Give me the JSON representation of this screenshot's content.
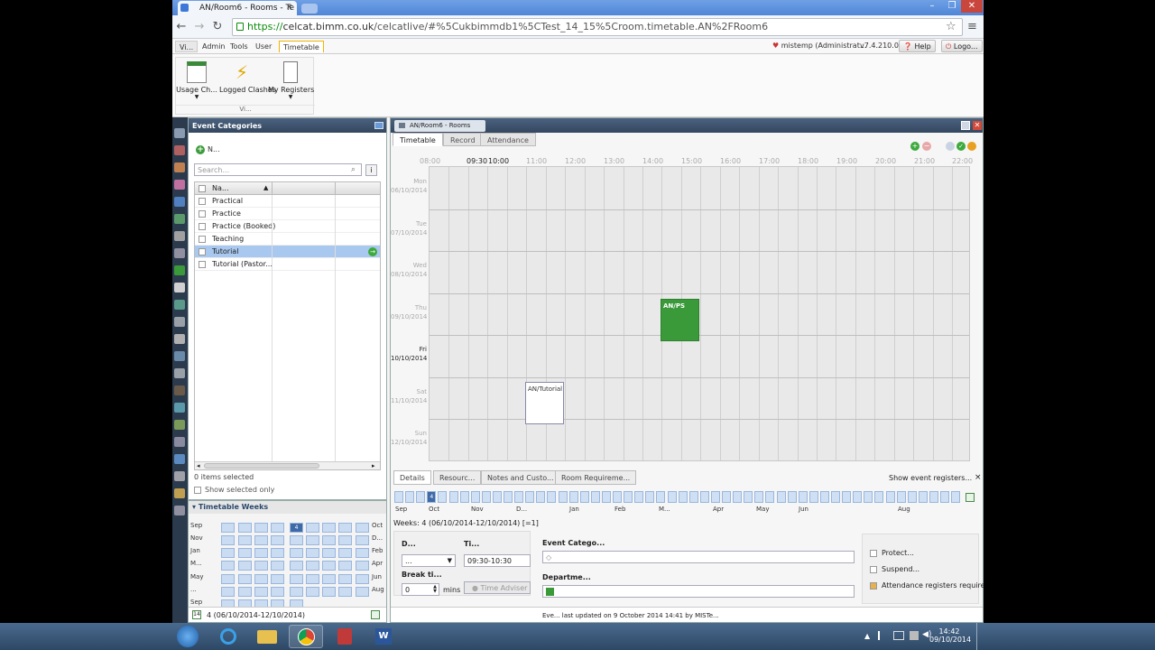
{
  "browser": {
    "tab_title": "AN/Room6 - Rooms - Te",
    "url_scheme": "https://",
    "url_domain": "celcat.bimm.co.uk",
    "url_path": "/celcatlive/#%5Cukbimmdb1%5CTest_14_15%5Croom.timetable.AN%2FRoom6"
  },
  "menu": {
    "items": [
      "Vi...",
      "Admin",
      "Tools",
      "User",
      "Timetable"
    ],
    "user": "mistemp (Administrat...",
    "version": "v7.4.210.0",
    "help": "Help",
    "logout": "Logo..."
  },
  "ribbon": {
    "items": [
      "Usage Ch...",
      "Logged Clashes",
      "My Registers"
    ],
    "group": "Vi..."
  },
  "event_categories": {
    "title": "Event Categories",
    "new_label": "N...",
    "search_placeholder": "Search...",
    "info_btn": "i",
    "col_name": "Na...",
    "rows": [
      "Practical",
      "Practice",
      "Practice (Booked)",
      "Teaching",
      "Tutorial",
      "Tutorial (Pastor..."
    ],
    "selected_index": 4,
    "status": "0 items selected",
    "show_selected": "Show selected only"
  },
  "timetable_weeks": {
    "title": "Timetable Weeks",
    "left_labels": [
      "Sep",
      "Nov",
      "Jan",
      "M...",
      "May",
      "...",
      "Sep"
    ],
    "right_labels": [
      "Oct",
      "D...",
      "Feb",
      "Apr",
      "Jun",
      "Aug"
    ],
    "current": "4",
    "footer": "4 (06/10/2014-12/10/2014)"
  },
  "main": {
    "window_title": "AN/Room6 - Rooms",
    "tabs": [
      "Timetable",
      "Record",
      "Attendance"
    ],
    "hours": [
      "08:00",
      "09:30",
      "10:00",
      "11:00",
      "12:00",
      "13:00",
      "14:00",
      "15:00",
      "16:00",
      "17:00",
      "18:00",
      "19:00",
      "20:00",
      "21:00",
      "22:00"
    ],
    "days": [
      {
        "d": "Mon",
        "date": "06/10/2014"
      },
      {
        "d": "Tue",
        "date": "07/10/2014"
      },
      {
        "d": "Wed",
        "date": "08/10/2014"
      },
      {
        "d": "Thu",
        "date": "09/10/2014"
      },
      {
        "d": "Fri",
        "date": "10/10/2014"
      },
      {
        "d": "Sat",
        "date": "11/10/2014"
      },
      {
        "d": "Sun",
        "date": "12/10/2014"
      }
    ],
    "events": [
      "AN/PS",
      "AN/Tutorial"
    ]
  },
  "details": {
    "tabs": [
      "Details",
      "Resourc...",
      "Notes and Custo...",
      "Room Requireme..."
    ],
    "show_registers": "Show event registers...",
    "close": "×",
    "months": [
      "Sep",
      "Oct",
      "Nov",
      "D...",
      "Jan",
      "Feb",
      "M...",
      "Apr",
      "May",
      "Jun",
      "Aug"
    ],
    "current_week": "4",
    "weeks_text": "Weeks: 4 (06/10/2014-12/10/2014) [=1]",
    "day_label": "D...",
    "day_value": "...",
    "time_label": "Ti...",
    "time_value": "09:30-10:30",
    "break_label": "Break ti...",
    "break_value": "0",
    "mins": "mins",
    "time_adviser": "Time Adviser",
    "event_category_label": "Event Catego...",
    "department_label": "Departme...",
    "protect": "Protect...",
    "suspend": "Suspend...",
    "attendance": "Attendance registers required",
    "footer": "Eve...   last updated on 9 October 2014 14:41 by  MISTe..."
  },
  "taskbar": {
    "time": "14:42",
    "date": "09/10/2014"
  }
}
